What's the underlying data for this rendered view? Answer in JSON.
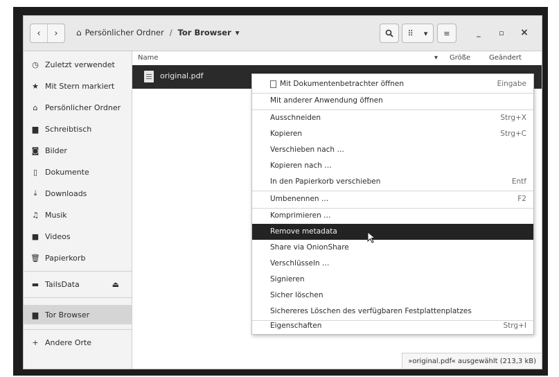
{
  "header": {
    "back_icon": "‹",
    "forward_icon": "›",
    "home_label": "Persönlicher Ordner",
    "separator": "/",
    "current_folder": "Tor Browser",
    "search_icon": "search-icon",
    "view_grid_icon": "⠿",
    "view_menu_icon": "▾",
    "hamburger_icon": "≡",
    "minimize": "_",
    "maximize": "▫",
    "close": "×"
  },
  "sidebar": {
    "items": [
      {
        "icon": "◷",
        "label": "Zuletzt verwendet"
      },
      {
        "icon": "★",
        "label": "Mit Stern markiert"
      },
      {
        "icon": "⌂",
        "label": "Persönlicher Ordner"
      },
      {
        "icon": "▆",
        "label": "Schreibtisch"
      },
      {
        "icon": "◙",
        "label": "Bilder"
      },
      {
        "icon": "▯",
        "label": "Dokumente"
      },
      {
        "icon": "⤓",
        "label": "Downloads"
      },
      {
        "icon": "♫",
        "label": "Musik"
      },
      {
        "icon": "■",
        "label": "Videos"
      },
      {
        "icon": "🗑",
        "label": "Papierkorb"
      },
      {
        "icon": "▬",
        "label": "TailsData",
        "eject": "⏏"
      },
      {
        "icon": "▆",
        "label": "Tor Browser"
      },
      {
        "icon": "+",
        "label": "Andere Orte"
      }
    ]
  },
  "columns": {
    "name": "Name",
    "size": "Größe",
    "modified": "Geändert",
    "sort_arrow": "▾"
  },
  "files": [
    {
      "name": "original.pdf"
    }
  ],
  "status_text": "»original.pdf« ausgewählt (213,3 kB)",
  "context_menu": {
    "items": [
      {
        "label": "Mit Dokumentenbetrachter öffnen",
        "accel": "Eingabe"
      },
      {
        "label": "Mit anderer Anwendung öffnen",
        "accel": ""
      },
      {
        "label": "Ausschneiden",
        "accel": "Strg+X"
      },
      {
        "label": "Kopieren",
        "accel": "Strg+C"
      },
      {
        "label": "Verschieben nach …",
        "accel": ""
      },
      {
        "label": "Kopieren nach …",
        "accel": ""
      },
      {
        "label": "In den Papierkorb verschieben",
        "accel": "Entf"
      },
      {
        "label": "Umbenennen …",
        "accel": "F2"
      },
      {
        "label": "Komprimieren …",
        "accel": ""
      },
      {
        "label": "Remove metadata",
        "accel": ""
      },
      {
        "label": "Share via OnionShare",
        "accel": ""
      },
      {
        "label": "Verschlüsseln …",
        "accel": ""
      },
      {
        "label": "Signieren",
        "accel": ""
      },
      {
        "label": "Sicher löschen",
        "accel": ""
      },
      {
        "label": "Sichereres Löschen des verfügbaren Festplattenplatzes",
        "accel": ""
      },
      {
        "label": "Eigenschaften",
        "accel": "Strg+I"
      }
    ]
  }
}
